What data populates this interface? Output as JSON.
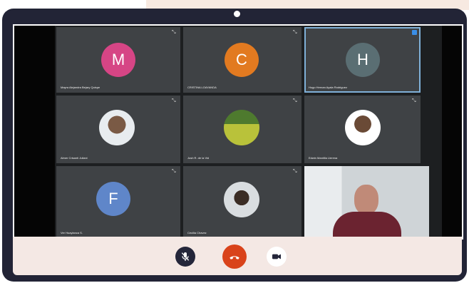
{
  "participants": [
    {
      "name": "Mayra Alejandra Bejary Quispe",
      "initial": "M",
      "color": "#d64585"
    },
    {
      "name": "CRISTINA LOAYANDA",
      "initial": "C",
      "color": "#e27a20"
    },
    {
      "name": "Hugo Hernan Ayala Rodriguez",
      "initial": "H",
      "color": "#5a6e73"
    },
    {
      "name": "Almer Crisanti Juliani"
    },
    {
      "name": "Josh R. de la Vid"
    },
    {
      "name": "Edwin Mantilla Llerena"
    },
    {
      "name": "Ver Huaylanca S.",
      "initial": "F",
      "color": "#5f86c9"
    },
    {
      "name": "Cecilia Chavez"
    }
  ],
  "controls": {
    "mute": "microphone-muted-icon",
    "end_call": "hang-up-icon",
    "video": "video-camera-icon",
    "colors": {
      "mute": "#24263a",
      "end_call": "#d9431b",
      "video": "#ffffff"
    }
  }
}
